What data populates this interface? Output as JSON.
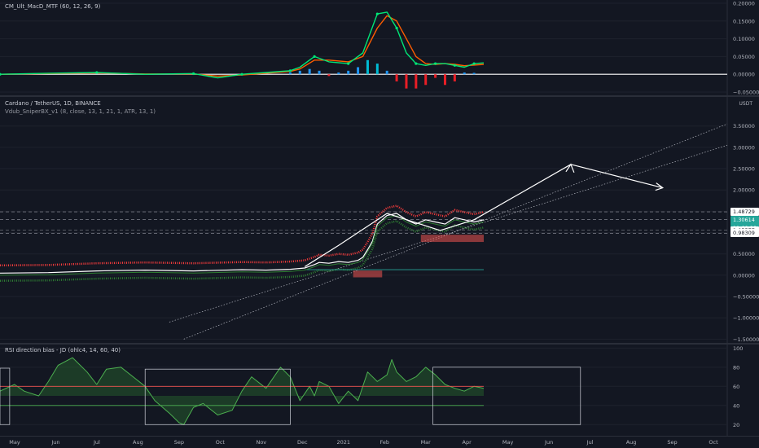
{
  "chart_data": [
    {
      "type": "line",
      "title": "CM_Ult_MacD_MTF (60, 12, 26, 9)",
      "ylim": [
        -0.05,
        0.2
      ],
      "yticks": [
        0.2,
        0.15,
        0.1,
        0.05,
        0.0,
        -0.05
      ],
      "ytick_labels": [
        "0.20000",
        "0.15000",
        "0.10000",
        "0.05000",
        "0.00000",
        "−0.05000"
      ],
      "x_range": [
        0,
        100
      ],
      "macd": {
        "x": [
          0,
          10,
          20,
          30,
          40,
          45,
          50,
          55,
          60,
          62,
          65,
          68,
          72,
          75,
          78,
          80,
          82,
          84,
          86,
          88,
          90,
          92,
          94,
          96,
          98,
          100
        ],
        "y": [
          0.0,
          0.003,
          0.005,
          0.0,
          0.002,
          -0.01,
          0.0,
          0.005,
          0.01,
          0.02,
          0.05,
          0.035,
          0.03,
          0.06,
          0.17,
          0.175,
          0.13,
          0.06,
          0.03,
          0.025,
          0.03,
          0.03,
          0.025,
          0.02,
          0.03,
          0.032
        ]
      },
      "signal": {
        "x": [
          0,
          10,
          20,
          30,
          40,
          45,
          50,
          55,
          60,
          62,
          65,
          68,
          72,
          75,
          78,
          80,
          82,
          84,
          86,
          88,
          90,
          92,
          94,
          96,
          98,
          100
        ],
        "y": [
          0.0,
          0.002,
          0.004,
          0.001,
          0.001,
          -0.005,
          -0.002,
          0.003,
          0.008,
          0.015,
          0.04,
          0.04,
          0.035,
          0.05,
          0.13,
          0.165,
          0.15,
          0.1,
          0.05,
          0.03,
          0.028,
          0.03,
          0.028,
          0.024,
          0.026,
          0.028
        ]
      },
      "histogram": {
        "x": [
          60,
          62,
          64,
          66,
          68,
          70,
          72,
          74,
          76,
          78,
          80,
          82,
          84,
          86,
          88,
          90,
          92,
          94,
          96,
          98
        ],
        "y": [
          0.005,
          0.01,
          0.015,
          0.01,
          -0.005,
          0.005,
          0.01,
          0.02,
          0.04,
          0.03,
          0.01,
          -0.02,
          -0.04,
          -0.04,
          -0.03,
          -0.01,
          -0.03,
          -0.02,
          0.005,
          0.004
        ]
      }
    },
    {
      "type": "line",
      "title": "Cardano / TetherUS, 1D, BINANCE",
      "subtitle": "Vdub_SniperBX_v1 (8, close, 13, 1, 21, 1, ATR, 13, 1)",
      "unit": "USDT",
      "ylim": [
        -1.55,
        3.8
      ],
      "yticks": [
        3.5,
        3.0,
        2.5,
        2.0,
        1.5,
        1.0,
        0.5,
        0.0,
        -0.5,
        -1.0,
        -1.5
      ],
      "ytick_labels": [
        "3.50000",
        "3.00000",
        "2.50000",
        "2.00000",
        "1.50000",
        "1.00000",
        "0.50000",
        "0.00000",
        "−0.50000",
        "−1.00000",
        "−1.50000"
      ],
      "price_tags": [
        {
          "value": 1.48729,
          "label": "1.48729",
          "style": "white"
        },
        {
          "value": 1.30614,
          "label": "1.30614",
          "time": "11:09:28",
          "style": "green"
        },
        {
          "value": 1.05577,
          "label": "1.05577",
          "style": "white"
        },
        {
          "value": 0.98309,
          "label": "0.98309",
          "style": "white"
        }
      ],
      "price": {
        "x": [
          0,
          10,
          20,
          30,
          40,
          50,
          55,
          60,
          63,
          65,
          66,
          68,
          70,
          72,
          74,
          75,
          76,
          77,
          78,
          80,
          82,
          84,
          86,
          88,
          90,
          92,
          94,
          96,
          98,
          100
        ],
        "y": [
          0.05,
          0.06,
          0.1,
          0.12,
          0.1,
          0.13,
          0.12,
          0.14,
          0.17,
          0.25,
          0.3,
          0.28,
          0.32,
          0.3,
          0.35,
          0.42,
          0.6,
          0.8,
          1.2,
          1.4,
          1.45,
          1.3,
          1.2,
          1.3,
          1.25,
          1.2,
          1.35,
          1.3,
          1.25,
          1.3
        ]
      },
      "projection": {
        "x": [
          63,
          70,
          80,
          91,
          98,
          118
        ],
        "y": [
          0.2,
          0.7,
          1.45,
          1.05,
          1.3,
          2.6
        ]
      },
      "projection_end": {
        "x": 137,
        "y": 2.05
      }
    },
    {
      "type": "area",
      "title": "RSI direction bias - JD (ohlc4, 14, 60, 40)",
      "ylim": [
        10,
        102
      ],
      "yticks": [
        100,
        80,
        60,
        40,
        20
      ],
      "ytick_labels": [
        "100",
        "80",
        "60",
        "40",
        "20"
      ],
      "bands": [
        60,
        40
      ],
      "rsi": {
        "x": [
          0,
          3,
          5,
          8,
          10,
          12,
          15,
          18,
          20,
          22,
          25,
          28,
          30,
          32,
          35,
          37,
          38,
          40,
          42,
          45,
          48,
          50,
          52,
          55,
          58,
          60,
          62,
          64,
          65,
          66,
          68,
          70,
          72,
          74,
          75,
          76,
          78,
          80,
          81,
          82,
          84,
          86,
          88,
          90,
          92,
          94,
          96,
          98,
          100
        ],
        "y": [
          55,
          62,
          55,
          50,
          65,
          82,
          90,
          75,
          62,
          78,
          80,
          68,
          60,
          45,
          32,
          22,
          20,
          38,
          42,
          30,
          35,
          55,
          70,
          58,
          80,
          70,
          45,
          60,
          50,
          65,
          60,
          42,
          55,
          45,
          60,
          75,
          65,
          72,
          88,
          75,
          65,
          70,
          80,
          72,
          62,
          58,
          55,
          60,
          58
        ]
      }
    }
  ],
  "xaxis": {
    "labels": [
      "May",
      "Jun",
      "Jul",
      "Aug",
      "Sep",
      "Oct",
      "Nov",
      "Dec",
      "2021",
      "Feb",
      "Mar",
      "Apr",
      "May",
      "Jun",
      "Jul",
      "Aug",
      "Sep",
      "Oct"
    ]
  }
}
